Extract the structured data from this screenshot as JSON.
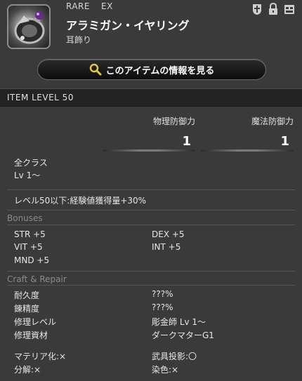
{
  "header": {
    "rarity": "RARE",
    "ex_label": "EX",
    "item_name": "アラミガン・イヤリング",
    "item_type": "耳飾り",
    "icon_names": [
      "plus-cross-icon",
      "lock-icon",
      "inventory-box-icon"
    ]
  },
  "view_button": {
    "label": "このアイテムの情報を見る",
    "icon": "magnifier-icon"
  },
  "item_level": "ITEM LEVEL 50",
  "stats": [
    {
      "label": "物理防御力",
      "value": "1"
    },
    {
      "label": "魔法防御力",
      "value": "1"
    }
  ],
  "requirements": {
    "classes": "全クラス",
    "level": "Lv 1～"
  },
  "effect": "レベル50以下:経験値獲得量+30%",
  "bonuses": {
    "heading": "Bonuses",
    "items": [
      {
        "label": "STR +5"
      },
      {
        "label": "DEX +5"
      },
      {
        "label": "VIT +5"
      },
      {
        "label": "INT +5"
      },
      {
        "label": "MND +5"
      }
    ]
  },
  "craft": {
    "heading": "Craft & Repair",
    "rows": [
      {
        "label": "耐久度",
        "value": "???%"
      },
      {
        "label": "錬精度",
        "value": "???%"
      },
      {
        "label": "修理レベル",
        "value": "彫金師 Lv 1～"
      },
      {
        "label": "修理資材",
        "value": "ダークマターG1"
      }
    ],
    "flags": [
      {
        "label": "マテリア化:×"
      },
      {
        "label": "武具投影:〇"
      },
      {
        "label": "分解:×"
      },
      {
        "label": "染色:×"
      }
    ]
  },
  "colors": {
    "background": "#3a3a3a",
    "ilevel_bar": "#232323",
    "section_heading": "#8a8a8a"
  }
}
